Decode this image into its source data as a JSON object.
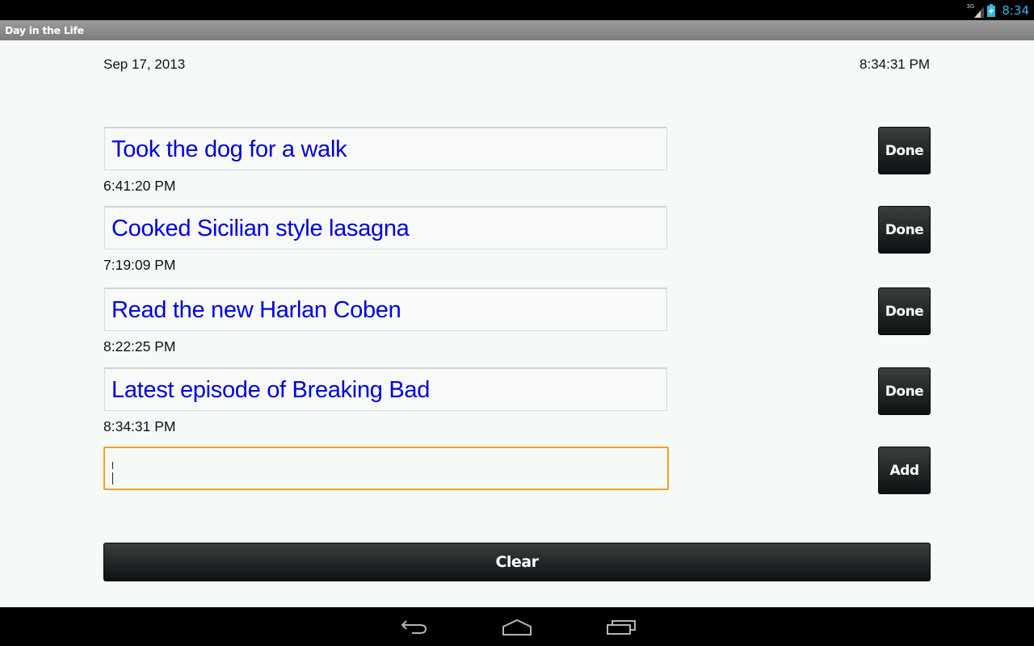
{
  "status_bar": {
    "network_label": "3G",
    "network_icon": "signal-icon",
    "battery_icon": "battery-charging-icon",
    "clock": "8:34",
    "clock_color": "#33b5e5"
  },
  "app": {
    "title": "Day in the Life"
  },
  "header": {
    "date": "Sep 17, 2013",
    "current_time": "8:34:31 PM"
  },
  "entries": [
    {
      "text": "Took the dog for a walk",
      "time": "6:41:20 PM",
      "button_label": "Done"
    },
    {
      "text": "Cooked Sicilian style lasagna",
      "time": "7:19:09 PM",
      "button_label": "Done"
    },
    {
      "text": "Read the new Harlan Coben",
      "time": "8:22:25 PM",
      "button_label": "Done"
    },
    {
      "text": "Latest episode of Breaking Bad",
      "time": "8:34:31 PM",
      "button_label": "Done"
    }
  ],
  "new_entry": {
    "value": "",
    "placeholder": "",
    "button_label": "Add",
    "focus_color": "#f59c27"
  },
  "clear_button_label": "Clear",
  "colors": {
    "entry_text": "#0000dd",
    "button_dark": "#0c1213"
  },
  "nav_bar": {
    "back_icon": "back-icon",
    "home_icon": "home-icon",
    "recents_icon": "recent-apps-icon"
  }
}
